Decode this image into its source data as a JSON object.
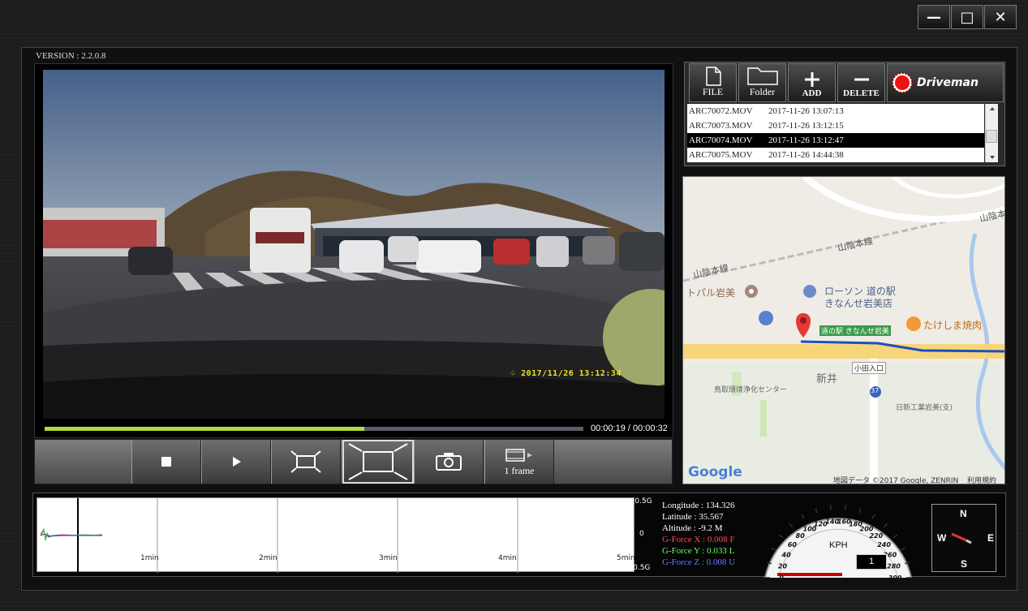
{
  "window": {
    "minimize_glyph": "—",
    "maximize_glyph": "□",
    "close_glyph": "✕"
  },
  "version": "VERSION : 2.2.0.8",
  "video": {
    "osd_timestamp": "2017/11/26 13:12:34",
    "elapsed": "00:00:19",
    "duration": "00:00:32",
    "time_readout": "00:00:19 / 00:00:32",
    "progress_fraction": 0.594
  },
  "controls": {
    "frame_label": "1 frame"
  },
  "toolbar": {
    "file_label": "FILE",
    "folder_label": "Folder",
    "add_label": "ADD",
    "delete_label": "DELETE",
    "brand": "Driveman"
  },
  "files": [
    {
      "name": "ARC70072.MOV",
      "date": "2017-11-26 13:07:13",
      "selected": false
    },
    {
      "name": "ARC70073.MOV",
      "date": "2017-11-26 13:12:15",
      "selected": false
    },
    {
      "name": "ARC70074.MOV",
      "date": "2017-11-26 13:12:47",
      "selected": true
    },
    {
      "name": "ARC70075.MOV",
      "date": "2017-11-26 14:44:38",
      "selected": false
    }
  ],
  "map": {
    "labels": {
      "rail_1": "山陰本線",
      "rail_2": "山陰本線",
      "rail_3": "山陰本",
      "toparu": "トパル岩美",
      "lawson": "ローソン 道の駅",
      "lawson_2": "きなんせ岩美店",
      "takeshima": "たけしま焼肉",
      "station": "道の駅 きなんせ岩美",
      "odairiguchi": "小田入口",
      "arai": "新井",
      "center": "鳥取環境浄化センター",
      "route": "37",
      "nisshin": "日新工業岩美(支)",
      "google": "Google",
      "copyright": "地図データ ©2017 Google, ZENRIN",
      "terms": "利用規約"
    }
  },
  "graph": {
    "tick_labels": [
      "1min",
      "2min",
      "3min",
      "4min",
      "5min"
    ],
    "scale_top": "+ 0.5G",
    "scale_mid": "0",
    "scale_bottom": "- 0.5G"
  },
  "telemetry": {
    "longitude": "Longitude : 134.326",
    "latitude": "Latitude : 35.567",
    "altitude": "Altitude : -9.2 M",
    "gforce_x": "G-Force X : 0.008 F",
    "gforce_y": "G-Force Y : 0.033 L",
    "gforce_z": "G-Force Z : 0.008 U",
    "colors": {
      "x": "#ff4a4a",
      "y": "#6cff6c",
      "z": "#6a7bff"
    }
  },
  "speedometer": {
    "unit": "KPH",
    "ticks": [
      "0",
      "20",
      "40",
      "60",
      "80",
      "100",
      "120",
      "140",
      "160",
      "180",
      "200",
      "220",
      "240",
      "260",
      "280",
      "300"
    ],
    "speed": "1"
  },
  "compass": {
    "n": "N",
    "s": "S",
    "e": "E",
    "w": "W"
  }
}
